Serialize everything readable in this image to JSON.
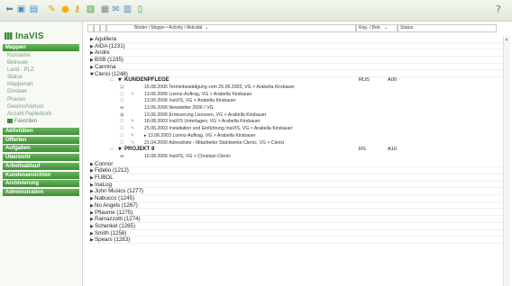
{
  "toolbar": {
    "icons": [
      {
        "name": "back-arrow-icon",
        "glyph": "⬅",
        "color": "#4a8ec7"
      },
      {
        "name": "module-icon",
        "glyph": "▣",
        "color": "#4a8ec7"
      },
      {
        "name": "window-icon",
        "glyph": "▤",
        "color": "#4a8ec7"
      },
      {
        "name": "pen-icon",
        "glyph": "✎",
        "color": "#d6a400"
      },
      {
        "name": "bulb-icon",
        "glyph": "●",
        "color": "#f0b400"
      },
      {
        "name": "key-icon",
        "glyph": "⚷",
        "color": "#c89a00"
      },
      {
        "name": "image-icon",
        "glyph": "▧",
        "color": "#4d9a48"
      },
      {
        "name": "document-icon",
        "glyph": "▦",
        "color": "#7a8a9a"
      },
      {
        "name": "mail-icon",
        "glyph": "✉",
        "color": "#4a8ec7"
      },
      {
        "name": "print-icon",
        "glyph": "▥",
        "color": "#4a8ec7"
      },
      {
        "name": "trash-icon",
        "glyph": "▯",
        "color": "#4d9a48"
      }
    ],
    "help_glyph": "?"
  },
  "sidebar": {
    "logo": "InaVIS",
    "active_section": "Mappen",
    "items": [
      "Kunname",
      "Betreuer",
      "Land - PLZ",
      "Status",
      "Mappenart",
      "Einsteer",
      "Phasen",
      "Gewinn/Verlust",
      "Anzahl Papierkorb"
    ],
    "icon_item": "Favoriten",
    "sections": [
      "Aktivitäten",
      "Offerten",
      "Aufgaben",
      "Übersicht",
      "Arbeitsablauf",
      "Kundenansichten",
      "Archivierung",
      "Administration"
    ]
  },
  "columns": {
    "main": "Binder / Mappe • Activity / Aktivität",
    "rep": "Rep. / Betr.",
    "status": "Status"
  },
  "tree": {
    "groups_before": [
      "Aguillera",
      "AIDA (1231)",
      "Andre",
      "BSB (1235)",
      "Carmina"
    ],
    "expanded_group": "Clerici (1248)",
    "section1": {
      "label": "KUNDENPFLEGE",
      "rep": "RUS",
      "status": "A00"
    },
    "activities": [
      {
        "text": "15.08.2006 Terminbestätigung vom 25.06.2003, VG > Arabella Kirsbauer",
        "icon": "▤",
        "edit": ""
      },
      {
        "text": "13.06.2006 Lizenz-Auftrag, VG > Arabella Kirsbauer",
        "icon": "☐",
        "edit": "✎"
      },
      {
        "text": "13.06.2006 InaVIS, VG > Arabella Kirsbauer",
        "icon": "☐",
        "edit": ""
      },
      {
        "text": "13.06.2006 Newsletter 2006 / VG",
        "icon": "▬",
        "edit": ""
      },
      {
        "text": "13.06.2006 Erneuerung Lizenzen, VG > Arabella Kirsbauer",
        "icon": "▦",
        "edit": ""
      },
      {
        "text": "18.08.2003 InaVIS Unterlagen, VG > Arabella Kirsbauer",
        "icon": "☐",
        "edit": "✎"
      },
      {
        "text": "25.06.2003 Installation und Einführung InaVIS, VG > Arabella Kirsbauer",
        "icon": "☐",
        "edit": "✎"
      },
      {
        "text": "▸ 13.06.2003 Lizenz-Auftrag, VG > Arabella Kirsbauer",
        "icon": "☐",
        "edit": "✎"
      },
      {
        "text": "21.04.2000 Adressliste - Mitarbeiter Stahlwerke Clerici, VG > Clerici",
        "icon": "☐",
        "edit": "✎"
      }
    ],
    "section2": {
      "label": "PROJEKT 8",
      "rep": "RS",
      "status": "A10"
    },
    "project_activity": {
      "text": "16.08.2006 InaVIS, VG > Christian Clerici",
      "icon": "▬"
    },
    "groups_after": [
      "Connor",
      "Fidelio (1212)",
      "FUBOL",
      "InaLog",
      "John Musics (1277)",
      "Nabucco (1245)",
      "No Angels (1267)",
      "Pflaume (1275)",
      "Ramazzotti (1274)",
      "Schenkel (1265)",
      "Smith (1258)",
      "Spears (1283)"
    ]
  },
  "colors": {
    "accent": "#3e8f35",
    "accent_light": "#6ab55f",
    "sidebar_item": "#7e9a7a"
  }
}
